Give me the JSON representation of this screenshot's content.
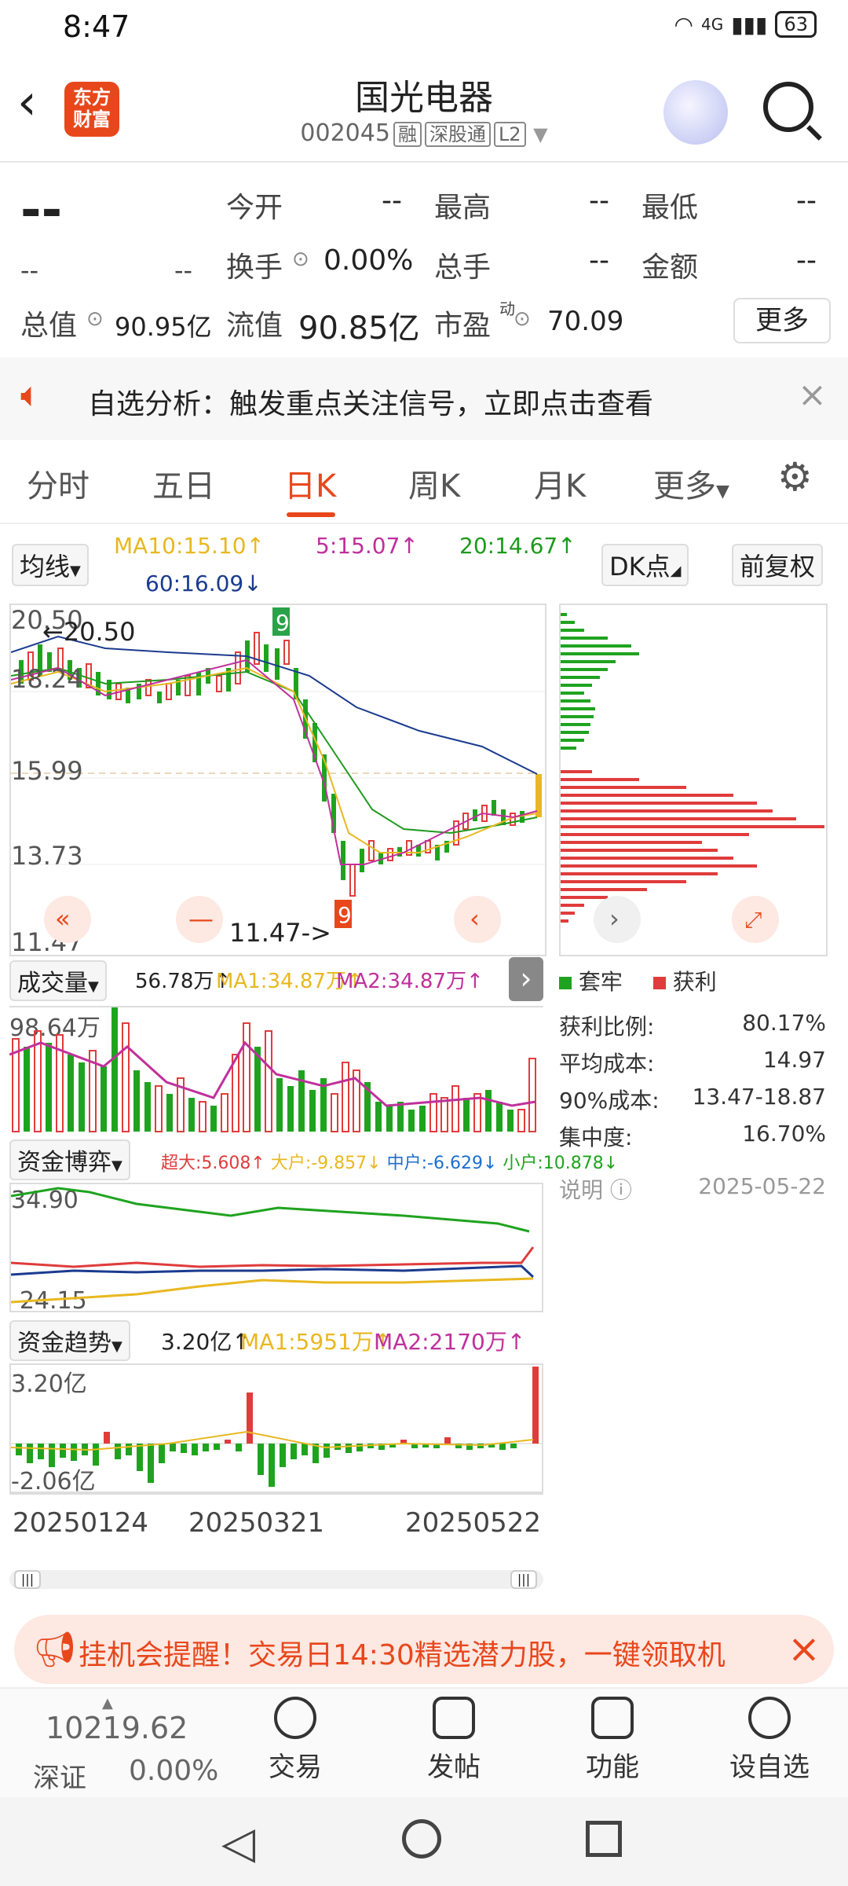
{
  "status": {
    "time": "8:47",
    "network": "4G",
    "battery": "63"
  },
  "header": {
    "logo_line1": "东方",
    "logo_line2": "财富",
    "title": "国光电器",
    "code": "002045",
    "tags": [
      "融",
      "深股通",
      "L2"
    ]
  },
  "quote": {
    "price": "--",
    "change": "--",
    "change_pct": "--",
    "open_label": "今开",
    "open": "--",
    "high_label": "最高",
    "high": "--",
    "low_label": "最低",
    "low": "--",
    "turnover_label": "换手",
    "turnover": "0.00%",
    "volume_label": "总手",
    "volume": "--",
    "amount_label": "金额",
    "amount": "--",
    "total_mv_label": "总值",
    "total_mv": "90.95亿",
    "float_mv_label": "流值",
    "float_mv": "90.85亿",
    "pe_label": "市盈",
    "pe_sup": "动",
    "pe": "70.09",
    "more_btn": "更多"
  },
  "notice": {
    "text": "自选分析：触发重点关注信号，立即点击查看"
  },
  "tabs": [
    {
      "label": "分时"
    },
    {
      "label": "五日"
    },
    {
      "label": "日K"
    },
    {
      "label": "周K"
    },
    {
      "label": "月K"
    },
    {
      "label": "更多"
    }
  ],
  "kline": {
    "ma_chip": "均线",
    "ma10": "MA10:15.10↑",
    "ma5": "5:15.07↑",
    "ma20": "20:14.67↑",
    "ma60": "60:16.09↓",
    "dk_chip": "DK点",
    "adj_chip": "前复权",
    "y_labels": [
      "20.50",
      "18.24",
      "15.99",
      "13.73",
      "11.47"
    ],
    "high_marker": "←20.50",
    "low_marker": "11.47->"
  },
  "chip_dist": {
    "legend_trapped": "套牢",
    "legend_profit": "获利",
    "rows": [
      {
        "label": "获利比例:",
        "value": "80.17%"
      },
      {
        "label": "平均成本:",
        "value": "14.97"
      },
      {
        "label": "90%成本:",
        "value": "13.47-18.87"
      },
      {
        "label": "集中度:",
        "value": "16.70%"
      }
    ],
    "note_label": "说明",
    "date": "2025-05-22"
  },
  "volume": {
    "chip": "成交量",
    "value": "56.78万↑",
    "ma1": "MA1:34.87万↑",
    "ma2": "MA2:34.87万↑",
    "ylabel": "98.64万"
  },
  "fund_game": {
    "chip": "资金博弈",
    "super": "超大:5.608↑",
    "large": "大户:-9.857↓",
    "mid": "中户:-6.629↓",
    "small": "小户:10.878↓",
    "ymax": "34.90",
    "ymin": "-24.15"
  },
  "fund_trend": {
    "chip": "资金趋势",
    "value": "3.20亿↑",
    "ma1": "MA1:5951万↑",
    "ma2": "MA2:2170万↑",
    "ymax": "3.20亿",
    "ymin": "-2.06亿"
  },
  "dates": [
    "20250124",
    "20250321",
    "20250522"
  ],
  "banner": {
    "text": "挂机会提醒！交易日14:30精选潜力股，一键领取机"
  },
  "index": {
    "value": "10219.62",
    "name": "深证",
    "pct": "0.00%"
  },
  "nav": [
    {
      "label": "交易"
    },
    {
      "label": "发帖"
    },
    {
      "label": "功能"
    },
    {
      "label": "设自选"
    }
  ],
  "colors": {
    "up": "#e03c3c",
    "down": "#1fa31f",
    "accent": "#e8471c",
    "ma5": "#e8b820",
    "ma10": "#c0309c",
    "ma20": "#1d9a1d",
    "ma60": "#1b3b8f"
  }
}
